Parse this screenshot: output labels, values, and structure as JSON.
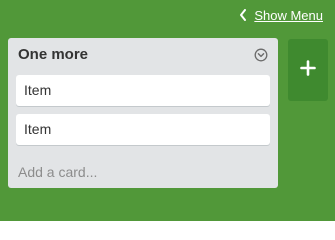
{
  "header": {
    "show_menu_label": "Show Menu",
    "chevron_icon": "chevron-left-icon"
  },
  "list": {
    "title": "One more",
    "menu_icon": "chevron-down-circle-icon",
    "cards": [
      {
        "label": "Item"
      },
      {
        "label": "Item"
      }
    ],
    "add_card_label": "Add a card..."
  },
  "add_list": {
    "icon": "plus-icon"
  },
  "colors": {
    "board_background": "#519839",
    "list_background": "#e2e4e6",
    "card_background": "#ffffff",
    "add_list_background": "#3f8a2f"
  }
}
